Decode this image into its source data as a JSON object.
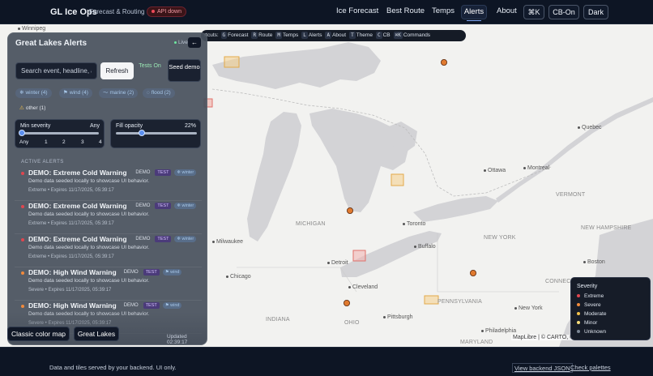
{
  "header": {
    "brand": "GL Ice Ops",
    "subtitle": "Forecast & Routing",
    "api_status": "API down",
    "nav": [
      "Ice Forecast",
      "Best Route",
      "Temps",
      "Alerts",
      "About"
    ],
    "active_nav": "Alerts",
    "buttons": {
      "command": "⌘K",
      "cb": "CB-On",
      "theme": "Dark"
    }
  },
  "shortcut_bar": {
    "prefix": "rtcuts:",
    "items": [
      {
        "key": "G",
        "label": "Forecast"
      },
      {
        "key": "R",
        "label": "Route"
      },
      {
        "key": "M",
        "label": "Temps"
      },
      {
        "key": "L",
        "label": "Alerts"
      },
      {
        "key": "A",
        "label": "About"
      },
      {
        "key": "T",
        "label": "Theme"
      },
      {
        "key": "C",
        "label": "CB"
      },
      {
        "key": "⌘K",
        "label": "Commands"
      }
    ]
  },
  "panel": {
    "title": "Great Lakes Alerts",
    "live": "Live",
    "collapse_icon": "←",
    "search_placeholder": "Search event, headline, a",
    "refresh": "Refresh",
    "tests": "Tests On",
    "seed": "Seed demo",
    "chips": [
      {
        "icon": "❄",
        "label": "winter (4)"
      },
      {
        "icon": "⚑",
        "label": "wind (4)"
      },
      {
        "icon": "〜",
        "label": "marine (2)"
      },
      {
        "icon": "◌",
        "label": "flood (2)"
      },
      {
        "icon": "⚠",
        "label": "other (1)"
      }
    ],
    "min_severity": {
      "label": "Min severity",
      "value": "Any",
      "ticks": [
        "Any",
        "1",
        "2",
        "3",
        "4"
      ],
      "level": 0
    },
    "fill_opacity": {
      "label": "Fill opacity",
      "value": "22%",
      "fraction": 0.22
    },
    "section_label": "ACTIVE ALERTS",
    "alerts": [
      {
        "title": "DEMO: Extreme Cold Warning",
        "demo": "DEMO",
        "test": "TEST",
        "tag": "❄ winter",
        "desc": "Demo data seeded locally to showcase UI behavior.",
        "meta": "Extreme • Expires 11/17/2025, 05:39:17",
        "color": "#e0464f"
      },
      {
        "title": "DEMO: Extreme Cold Warning",
        "demo": "DEMO",
        "test": "TEST",
        "tag": "❄ winter",
        "desc": "Demo data seeded locally to showcase UI behavior.",
        "meta": "Extreme • Expires 11/17/2025, 05:39:17",
        "color": "#e0464f"
      },
      {
        "title": "DEMO: Extreme Cold Warning",
        "demo": "DEMO",
        "test": "TEST",
        "tag": "❄ winter",
        "desc": "Demo data seeded locally to showcase UI behavior.",
        "meta": "Extreme • Expires 11/17/2025, 05:39:17",
        "color": "#e0464f"
      },
      {
        "title": "DEMO: High Wind Warning",
        "demo": "DEMO",
        "test": "TEST",
        "tag": "⚑ wind",
        "desc": "Demo data seeded locally to showcase UI behavior.",
        "meta": "Severe • Expires 11/17/2025, 05:39:17",
        "color": "#f08a3c"
      },
      {
        "title": "DEMO: High Wind Warning",
        "demo": "DEMO",
        "test": "TEST",
        "tag": "⚑ wind",
        "desc": "Demo data seeded locally to showcase UI behavior.",
        "meta": "Severe • Expires 11/17/2025, 05:39:17",
        "color": "#f08a3c"
      }
    ],
    "updated": "Updated 02:39:17",
    "classic_button": "Classic color map",
    "great_lakes_button": "Great Lakes"
  },
  "map": {
    "labels": [
      {
        "text": "Winnipeg",
        "kind": "city"
      },
      {
        "text": "Quebec",
        "kind": "city"
      },
      {
        "text": "Ottawa",
        "kind": "city"
      },
      {
        "text": "Montreal",
        "kind": "city"
      },
      {
        "text": "VERMONT",
        "kind": "state"
      },
      {
        "text": "NEW HAMPSHIRE",
        "kind": "state"
      },
      {
        "text": "NEW YORK",
        "kind": "state"
      },
      {
        "text": "MICHIGAN",
        "kind": "state"
      },
      {
        "text": "Toronto",
        "kind": "city"
      },
      {
        "text": "Buffalo",
        "kind": "city"
      },
      {
        "text": "Milwaukee",
        "kind": "city"
      },
      {
        "text": "Detroit",
        "kind": "city"
      },
      {
        "text": "Chicago",
        "kind": "city"
      },
      {
        "text": "Cleveland",
        "kind": "city"
      },
      {
        "text": "Boston",
        "kind": "city"
      },
      {
        "text": "CONNEC",
        "kind": "state"
      },
      {
        "text": "PENNSYLVANIA",
        "kind": "state"
      },
      {
        "text": "New York",
        "kind": "city"
      },
      {
        "text": "INDIANA",
        "kind": "state"
      },
      {
        "text": "OHIO",
        "kind": "state"
      },
      {
        "text": "Pittsburgh",
        "kind": "city"
      },
      {
        "text": "Philadelphia",
        "kind": "city"
      },
      {
        "text": "MARYLAND",
        "kind": "state"
      }
    ],
    "attribution": "MapLibre | © CARTO, ©"
  },
  "legend": {
    "title": "Severity",
    "items": [
      {
        "label": "Extreme",
        "color": "#e0464f"
      },
      {
        "label": "Severe",
        "color": "#f08a3c"
      },
      {
        "label": "Moderate",
        "color": "#f2c14b"
      },
      {
        "label": "Minor",
        "color": "#f5dc7a"
      },
      {
        "label": "Unknown",
        "color": "#7b8694"
      }
    ]
  },
  "footer": {
    "note": "Data and tiles served by your backend. UI only.",
    "view_json": "View backend JSON",
    "check_palettes": "Check palettes"
  }
}
